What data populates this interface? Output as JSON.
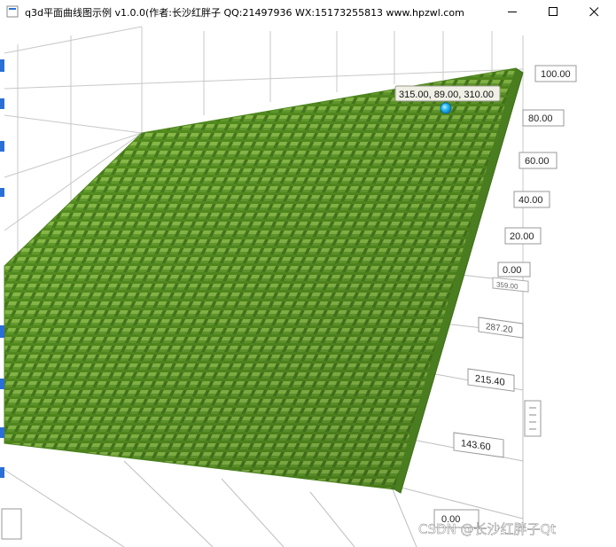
{
  "window": {
    "title": "q3d平面曲线图示例 v1.0.0(作者:长沙红胖子 QQ:21497936 WX:15173255813 www.hpzwl.com",
    "minimize_icon": "minimize-icon",
    "maximize_icon": "maximize-icon",
    "close_icon": "close-icon"
  },
  "chart": {
    "y_axis_labels": [
      "100.00",
      "80.00",
      "60.00",
      "40.00",
      "20.00",
      "0.00"
    ],
    "z_axis_labels": [
      "359.00",
      "287.20",
      "215.40",
      "143.60"
    ],
    "side_label": "0.00",
    "selection_tooltip": "315.00, 89.00, 310.00",
    "surface_color": "#6aa532",
    "selection_color": "#27b8f2"
  },
  "watermark": "CSDN @长沙红胖子Qt",
  "chart_data": {
    "type": "surface",
    "style": "bars-3d",
    "y_ticks": [
      0,
      20,
      40,
      60,
      80,
      100
    ],
    "z_ticks": [
      143.6,
      215.4,
      287.2,
      359.0
    ],
    "selected_point": {
      "x": 315.0,
      "y": 89.0,
      "z": 310.0
    }
  }
}
